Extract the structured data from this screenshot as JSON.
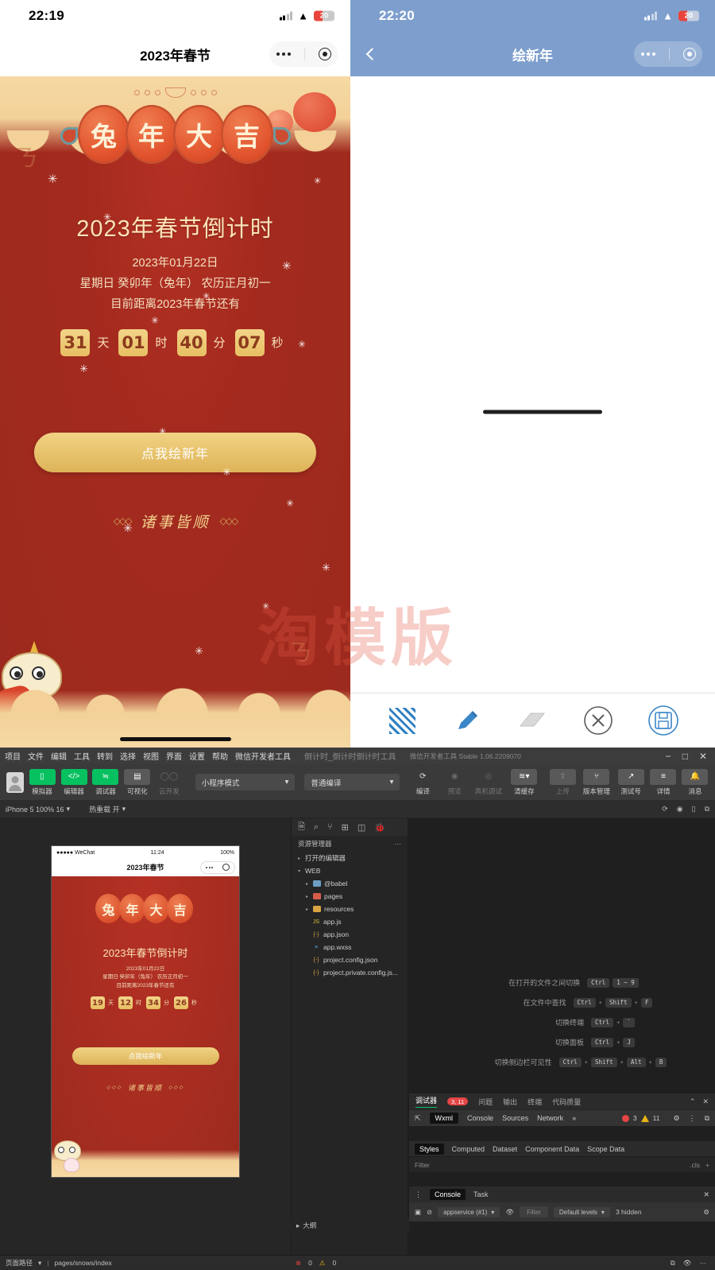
{
  "phone_left": {
    "status": {
      "time": "22:19",
      "battery": "20"
    },
    "nav": {
      "title": "2023年春节"
    },
    "plaque": [
      "兔",
      "年",
      "大",
      "吉"
    ],
    "title": "2023年春节倒计时",
    "date_line": "2023年01月22日",
    "lunar_line": "星期日 癸卯年（兔年）  农历正月初一",
    "remaining_line": "目前距离2023年春节还有",
    "countdown": [
      {
        "value": "31",
        "unit": "天"
      },
      {
        "value": "01",
        "unit": "时"
      },
      {
        "value": "40",
        "unit": "分"
      },
      {
        "value": "07",
        "unit": "秒"
      }
    ],
    "button": "点我绘新年",
    "wish": "诸事皆顺",
    "wish_ornament": "◇◇◇",
    "watermark": "淘模版"
  },
  "phone_right": {
    "status": {
      "time": "22:20",
      "battery": "20"
    },
    "nav": {
      "title": "绘新年",
      "back_icon": "chevron-left-icon"
    },
    "tools": [
      {
        "name": "pattern-fill-tool",
        "label": "hatch"
      },
      {
        "name": "pen-tool",
        "label": "pencil"
      },
      {
        "name": "eraser-tool",
        "label": "eraser"
      },
      {
        "name": "clear-tool",
        "label": "clear"
      },
      {
        "name": "save-tool",
        "label": "save"
      }
    ]
  },
  "ide": {
    "menubar": {
      "items": [
        "项目",
        "文件",
        "编辑",
        "工具",
        "转到",
        "选择",
        "视图",
        "界面",
        "设置",
        "帮助",
        "微信开发者工具"
      ],
      "project": "倒计时_倒计时倒计时工具",
      "version": "微信开发者工具 Stable 1.06.2209070",
      "window_controls": [
        "−",
        "□",
        "✕"
      ]
    },
    "toolbar": {
      "left_items": [
        {
          "label": "模拟器",
          "icon": "phone-icon",
          "active": true
        },
        {
          "label": "编辑器",
          "icon": "code-icon",
          "active": true
        },
        {
          "label": "调试器",
          "icon": "bug-icon",
          "active": true
        },
        {
          "label": "可视化",
          "icon": "layout-icon",
          "active": false
        },
        {
          "label": "云开发",
          "icon": "cloud-icon",
          "active": false
        }
      ],
      "mode_select": "小程序模式",
      "compile_select": "普通编译",
      "mid_items": [
        {
          "label": "编译",
          "icon": "refresh-icon"
        },
        {
          "label": "预览",
          "icon": "eye-icon"
        },
        {
          "label": "真机调试",
          "icon": "device-icon"
        },
        {
          "label": "清缓存",
          "icon": "layers-icon"
        }
      ],
      "right_items": [
        {
          "label": "上传",
          "icon": "upload-icon"
        },
        {
          "label": "版本管理",
          "icon": "branch-icon"
        },
        {
          "label": "测试号",
          "icon": "external-icon"
        },
        {
          "label": "详情",
          "icon": "list-icon"
        },
        {
          "label": "消息",
          "icon": "bell-icon"
        }
      ]
    },
    "subbar": {
      "device": "iPhone 5 100% 16",
      "theme": "热重载 开"
    },
    "simulator": {
      "status": {
        "carrier": "●●●●● WeChat",
        "time": "11:24",
        "battery": "100%"
      },
      "nav_title": "2023年春节",
      "plaque": [
        "兔",
        "年",
        "大",
        "吉"
      ],
      "title": "2023年春节倒计时",
      "date_line": "2023年01月22日",
      "lunar_line": "星期日 癸卯年（兔年）  农历正月初一",
      "remaining_line": "目前距离2023年春节还有",
      "countdown": [
        {
          "value": "19",
          "unit": "天"
        },
        {
          "value": "12",
          "unit": "时"
        },
        {
          "value": "34",
          "unit": "分"
        },
        {
          "value": "26",
          "unit": "秒"
        }
      ],
      "button": "点我绘新年",
      "wish": "诸事皆顺"
    },
    "explorer": {
      "activity_icons": [
        "files-icon",
        "search-icon",
        "source-control-icon",
        "extensions-icon",
        "layout-icon",
        "debug-icon"
      ],
      "header": "资源管理器",
      "header_more": "···",
      "rows": [
        {
          "label": "打开的编辑器",
          "type": "section",
          "depth": 0,
          "caret": "▸"
        },
        {
          "label": "WEB",
          "type": "section",
          "depth": 0,
          "caret": "▾"
        },
        {
          "label": "@babel",
          "type": "folder",
          "depth": 1,
          "caret": "▸",
          "color": "#6e9dc4"
        },
        {
          "label": "pages",
          "type": "folder",
          "depth": 1,
          "caret": "▸",
          "color": "#d85c4a"
        },
        {
          "label": "resources",
          "type": "folder",
          "depth": 1,
          "caret": "▸",
          "color": "#d9a441"
        },
        {
          "label": "app.js",
          "type": "file",
          "depth": 2,
          "icon": "JS",
          "color": "#e3c23c"
        },
        {
          "label": "app.json",
          "type": "file",
          "depth": 2,
          "icon": "{-}",
          "color": "#d9a441"
        },
        {
          "label": "app.wxss",
          "type": "file",
          "depth": 2,
          "icon": "≡",
          "color": "#4aa3d8"
        },
        {
          "label": "project.config.json",
          "type": "file",
          "depth": 2,
          "icon": "{-}",
          "color": "#d9a441"
        },
        {
          "label": "project.private.config.js...",
          "type": "file",
          "depth": 2,
          "icon": "{-}",
          "color": "#d9a441"
        }
      ]
    },
    "editor_shortcuts": [
      {
        "label": "在打开的文件之间切换",
        "keys": [
          "Ctrl",
          "1 ~ 9"
        ],
        "sep": false
      },
      {
        "label": "在文件中查找",
        "keys": [
          "Ctrl",
          "Shift",
          "F"
        ],
        "sep": true
      },
      {
        "label": "切换终端",
        "keys": [
          "Ctrl",
          "`"
        ],
        "sep": true
      },
      {
        "label": "切换面板",
        "keys": [
          "Ctrl",
          "J"
        ],
        "sep": true
      },
      {
        "label": "切换侧边栏可见性",
        "keys": [
          "Ctrl",
          "Shift",
          "Alt",
          "B"
        ],
        "sep": true
      }
    ],
    "debugger": {
      "tabs": [
        "调试器",
        "问题",
        "输出",
        "终端",
        "代码质量"
      ],
      "active_tab": "调试器",
      "badge": "3, 11",
      "collapse_icon": "chevron-up-icon",
      "close_icon": "close-icon",
      "dev_tabs": [
        "Wxml",
        "Console",
        "Sources",
        "Network"
      ],
      "dev_active": "Wxml",
      "more": "»",
      "errors": "3",
      "warnings": "11",
      "dev_icons": [
        "inspect-icon",
        "settings-icon",
        "more-icon",
        "dock-icon"
      ],
      "styles_tabs": [
        "Styles",
        "Computed",
        "Dataset",
        "Component Data",
        "Scope Data"
      ],
      "styles_active": "Styles",
      "filter_placeholder": "Filter",
      "filter_right": ".cls",
      "filter_plus": "+"
    },
    "console_panel": {
      "tabs": [
        "Console",
        "Task"
      ],
      "active": "Console",
      "close_icon": "close-icon",
      "context": "appservice (#1)",
      "filter_placeholder": "Filter",
      "levels": "Default levels",
      "hidden": "3 hidden",
      "eye_icon": "eye-icon",
      "clear_icon": "clear-icon",
      "settings_icon": "settings-icon",
      "sidebar_icon": "sidebar-icon"
    },
    "outline": {
      "caret": "▸",
      "label": "大纲"
    },
    "status_bar": {
      "left": "页面路径",
      "path": "pages/snows/index",
      "mid_icons": [
        "split-icon",
        "eye-icon",
        "more-icon"
      ],
      "errors": "0",
      "warnings": "0",
      "right_icon": "bell-icon"
    }
  },
  "colors": {
    "festive_red": "#9c2a1e",
    "gold": "#e7bf62",
    "wechat_green": "#07c160",
    "ide_bg": "#2b2b2b",
    "phone_right_bg": "#7e9fcd",
    "error_red": "#e54545",
    "warn_yellow": "#e7b416"
  }
}
